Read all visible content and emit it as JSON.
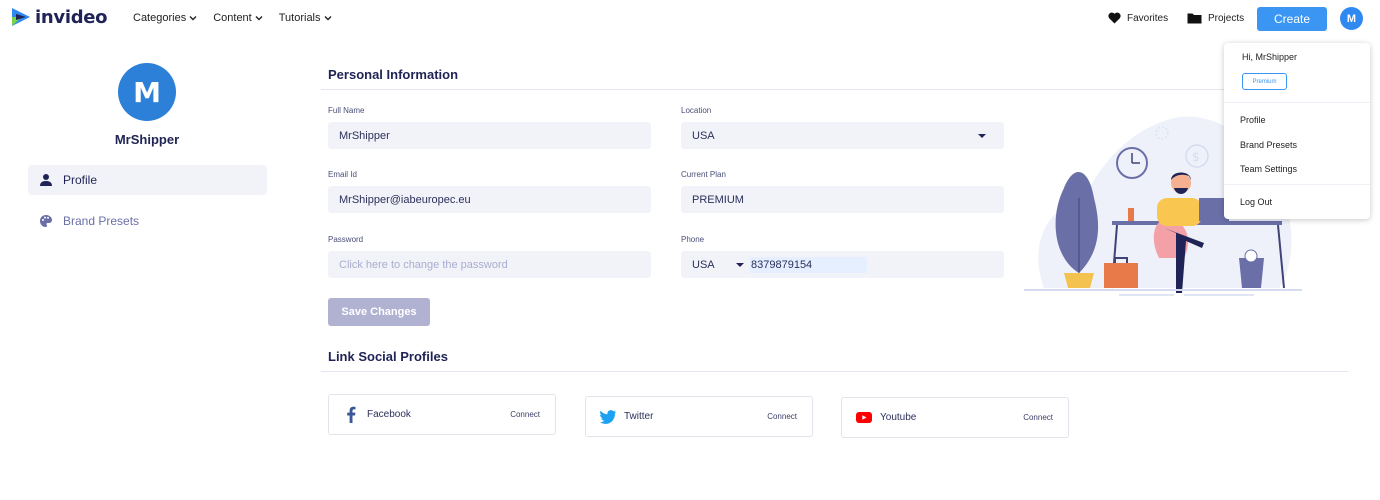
{
  "brand": {
    "name": "invideo"
  },
  "nav": {
    "menus": [
      {
        "label": "Categories"
      },
      {
        "label": "Content"
      },
      {
        "label": "Tutorials"
      }
    ],
    "favorites_label": "Favorites",
    "projects_label": "Projects",
    "create_label": "Create",
    "avatar_initial": "M"
  },
  "sidebar": {
    "avatar_initial": "M",
    "username": "MrShipper",
    "items": [
      {
        "label": "Profile",
        "icon": "user-icon",
        "active": true
      },
      {
        "label": "Brand Presets",
        "icon": "palette-icon",
        "active": false
      }
    ]
  },
  "personal_info": {
    "title": "Personal Information",
    "full_name": {
      "label": "Full Name",
      "value": "MrShipper"
    },
    "email": {
      "label": "Email Id",
      "value": "MrShipper@iabeuropec.eu"
    },
    "password": {
      "label": "Password",
      "placeholder": "Click here to change the password"
    },
    "location": {
      "label": "Location",
      "value": "USA"
    },
    "current_plan": {
      "label": "Current Plan",
      "value": "PREMIUM"
    },
    "phone": {
      "label": "Phone",
      "country": "USA",
      "number": "8379879154"
    },
    "save_label": "Save Changes"
  },
  "social": {
    "title": "Link Social Profiles",
    "items": [
      {
        "name": "Facebook",
        "icon": "facebook-icon",
        "action": "Connect",
        "color": "#3b5998"
      },
      {
        "name": "Twitter",
        "icon": "twitter-icon",
        "action": "Connect",
        "color": "#1da1f2"
      },
      {
        "name": "Youtube",
        "icon": "youtube-icon",
        "action": "Connect",
        "color": "#ff0000"
      }
    ]
  },
  "user_menu": {
    "greeting": "Hi, MrShipper",
    "plan_badge": "Premium",
    "items": [
      {
        "label": "Profile"
      },
      {
        "label": "Brand Presets"
      },
      {
        "label": "Team Settings"
      }
    ],
    "logout_label": "Log Out"
  },
  "colors": {
    "accent": "#3a96f2",
    "avatar": "#2c80d8",
    "text_dark": "#1f2355",
    "field_bg": "#f2f3f8",
    "save_disabled": "#b1b1d2"
  }
}
